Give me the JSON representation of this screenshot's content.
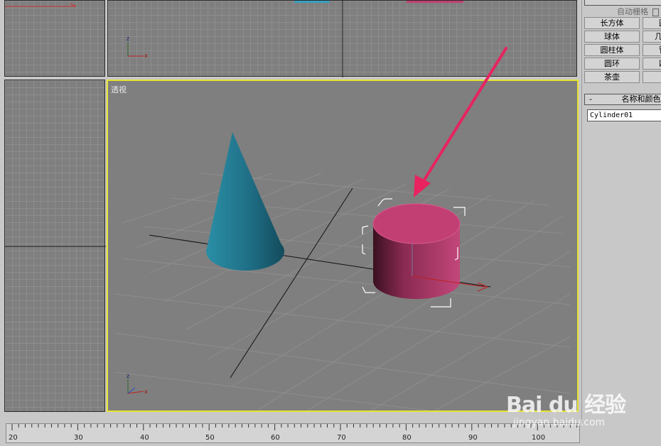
{
  "viewports": {
    "perspective_label": "透视"
  },
  "right_panel": {
    "auto_grid_label": "自动栅格",
    "primitives": [
      "长方体",
      "球体",
      "圆柱体",
      "圆环",
      "茶壶"
    ],
    "primitives_partial": [
      "圆",
      "几",
      "管",
      "四",
      ""
    ],
    "name_color_rollout": "名称和颜色",
    "rollout_collapse": "-",
    "object_name": "Cylinder01"
  },
  "timeline": {
    "ticks": [
      "20",
      "30",
      "40",
      "50",
      "60",
      "70",
      "80",
      "90",
      "100"
    ]
  },
  "watermark": {
    "logo": "Bai du 经验",
    "url": "jingyan.baidu.com"
  },
  "colors": {
    "active_viewport_border": "#e6e232",
    "cone": "#1f6f86",
    "cylinder": "#c23f74",
    "arrow": "#e8235f"
  }
}
